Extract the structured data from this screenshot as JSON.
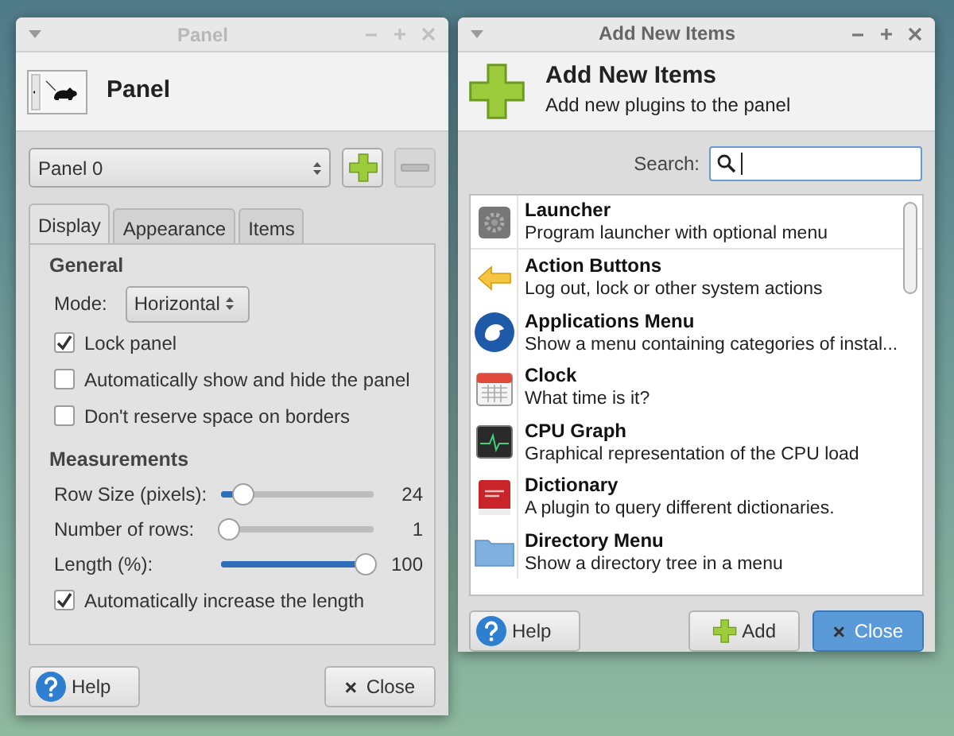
{
  "panel_window": {
    "title": "Panel",
    "header": "Panel",
    "panel_select": {
      "value": "Panel 0"
    },
    "tabs": [
      {
        "label": "Display",
        "selected": true
      },
      {
        "label": "Appearance",
        "selected": false
      },
      {
        "label": "Items",
        "selected": false
      }
    ],
    "general": {
      "heading": "General",
      "mode_label": "Mode:",
      "mode_value": "Horizontal",
      "options": [
        {
          "label": "Lock panel",
          "checked": true
        },
        {
          "label": "Automatically show and hide the panel",
          "checked": false
        },
        {
          "label": "Don't reserve space on borders",
          "checked": false
        }
      ]
    },
    "measurements": {
      "heading": "Measurements",
      "sliders": [
        {
          "label": "Row Size (pixels):",
          "level": 0.1,
          "reading": "24"
        },
        {
          "label": "Number of rows:",
          "level": 0.0,
          "reading": "1"
        },
        {
          "label": "Length (%):",
          "level": 1.0,
          "reading": "100"
        }
      ],
      "option": {
        "label": "Automatically increase the length",
        "checked": true
      }
    },
    "buttons": {
      "help": "Help",
      "close": "Close"
    }
  },
  "add_window": {
    "title": "Add New Items",
    "header_title": "Add New Items",
    "header_subtitle": "Add new plugins to the panel",
    "search_label": "Search:",
    "items": [
      {
        "name": "Launcher",
        "description": "Program launcher with optional menu"
      },
      {
        "name": "Action Buttons",
        "description": "Log out, lock or other system actions"
      },
      {
        "name": "Applications Menu",
        "description": "Show a menu containing categories of instal..."
      },
      {
        "name": "Clock",
        "description": "What time is it?"
      },
      {
        "name": "CPU Graph",
        "description": "Graphical representation of the CPU load"
      },
      {
        "name": "Dictionary",
        "description": "A plugin to query different dictionaries."
      },
      {
        "name": "Directory Menu",
        "description": "Show a directory tree in a menu"
      }
    ],
    "buttons": {
      "help": "Help",
      "add": "Add",
      "close": "Close"
    }
  }
}
